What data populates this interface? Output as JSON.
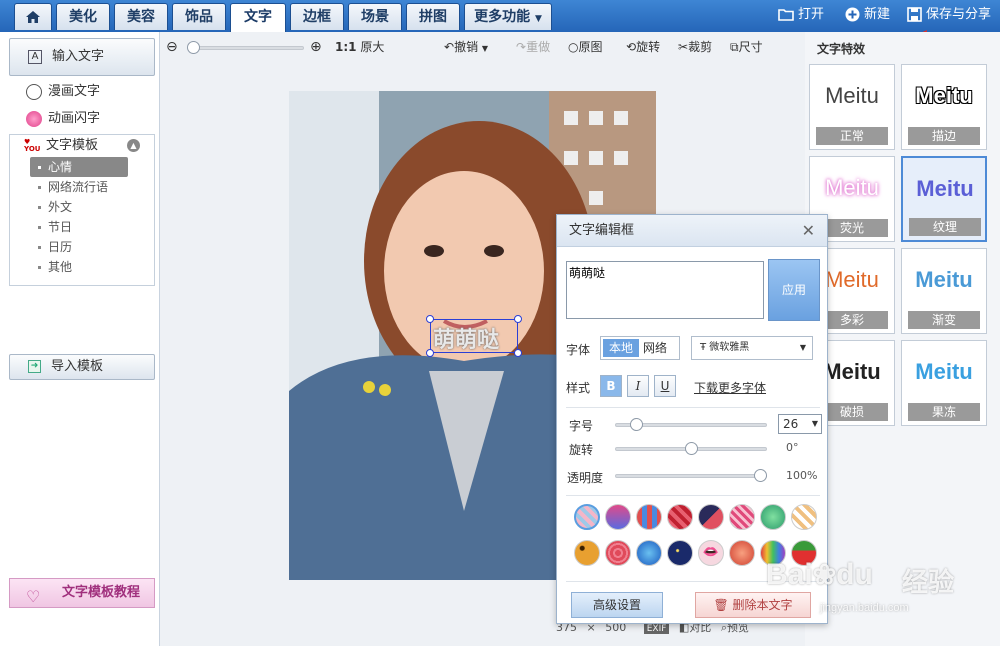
{
  "topbar": {
    "tabs": [
      "美化",
      "美容",
      "饰品",
      "文字",
      "边框",
      "场景",
      "拼图",
      "更多功能"
    ],
    "active_tab": "文字",
    "actions": {
      "open": "打开",
      "new": "新建",
      "save_share": "保存与分享"
    }
  },
  "sidebar": {
    "input_text": "输入文字",
    "comic_text": "漫画文字",
    "animated_text": "动画闪字",
    "template_title": "文字模板",
    "template_items": [
      "心情",
      "网络流行语",
      "外文",
      "节日",
      "日历",
      "其他"
    ],
    "selected_template": "心情",
    "import_template": "导入模板",
    "tutorial": "文字模板教程"
  },
  "toolbar": {
    "zoom_ratio": "1:1",
    "original_size": "原大",
    "undo": "撤销",
    "redo": "重做",
    "original_image": "原图",
    "rotate": "旋转",
    "crop": "裁剪",
    "size": "尺寸"
  },
  "canvas": {
    "text_overlay": "萌萌哒",
    "image_width": "375",
    "times": "×",
    "image_height": "500",
    "exif": "EXIF",
    "compare": "对比",
    "preview": "预览"
  },
  "effects_panel": {
    "title": "文字特效",
    "items": [
      {
        "sample": "Meitu",
        "label": "正常"
      },
      {
        "sample": "Meitu",
        "label": "描边"
      },
      {
        "sample": "Meitu",
        "label": "荧光"
      },
      {
        "sample": "Meitu",
        "label": "纹理"
      },
      {
        "sample": "Meitu",
        "label": "多彩"
      },
      {
        "sample": "Meitu",
        "label": "渐变"
      },
      {
        "sample": "Meitu",
        "label": "破损"
      },
      {
        "sample": "Meitu",
        "label": "果冻"
      }
    ],
    "selected": "纹理"
  },
  "dialog": {
    "title": "文字编辑框",
    "text_value": "萌萌哒",
    "apply": "应用",
    "font_label": "字体",
    "font_local": "本地",
    "font_network": "网络",
    "font_selected": "微软雅黑",
    "style_label": "样式",
    "bold": "B",
    "italic": "I",
    "underline": "U",
    "download_fonts": "下载更多字体",
    "size_label": "字号",
    "size_value": "26",
    "rotate_label": "旋转",
    "rotate_value": "0°",
    "rotate_level": 0.5,
    "opacity_label": "透明度",
    "opacity_value": "100%",
    "opacity_level": 1.0,
    "size_level": 0.1,
    "advanced": "高级设置",
    "delete_text": "删除本文字"
  },
  "watermark": {
    "brand": "Bai",
    "brand2": "du",
    "cn": "经验",
    "url": "jingyan.baidu.com"
  }
}
